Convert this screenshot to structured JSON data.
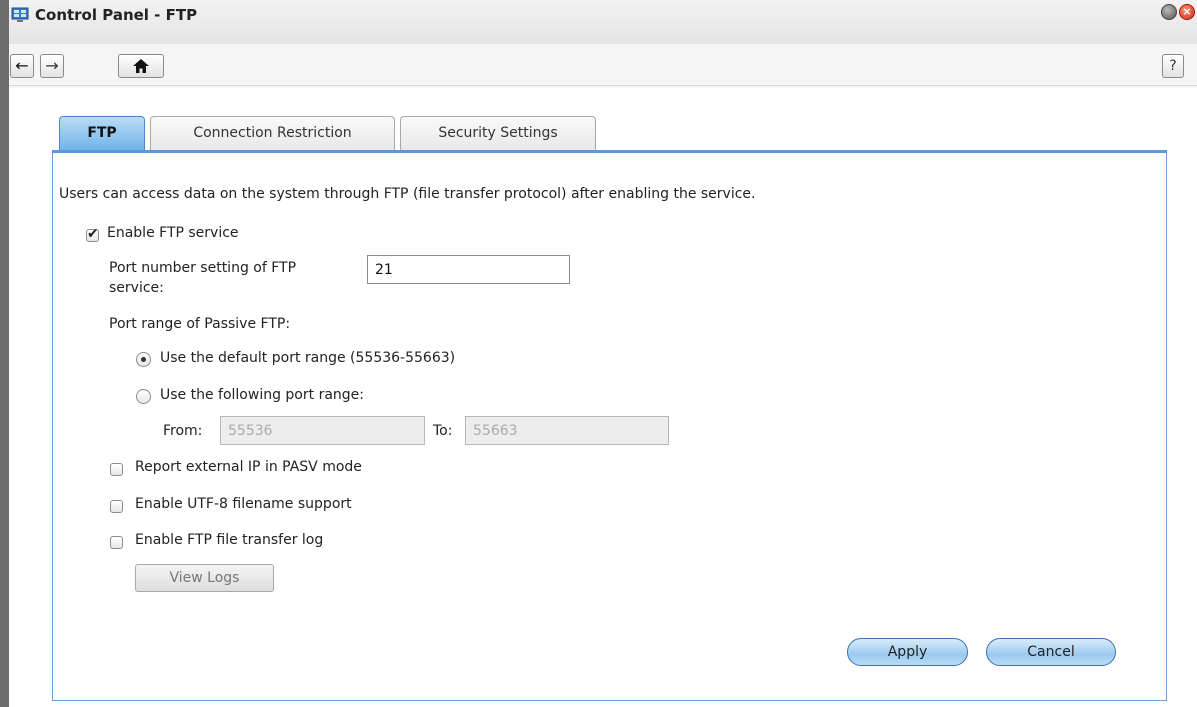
{
  "window": {
    "title": "Control Panel - FTP",
    "app_icon": "control-panel-icon",
    "minimize_icon": "minimize-icon",
    "close_icon": "close-icon"
  },
  "toolbar": {
    "back_icon": "←",
    "forward_icon": "→",
    "home_icon": "⌂",
    "help_label": "?"
  },
  "tabs": [
    {
      "label": "FTP",
      "active": true
    },
    {
      "label": "Connection Restriction",
      "active": false
    },
    {
      "label": "Security Settings",
      "active": false
    }
  ],
  "ftp": {
    "description": "Users can access data on the system through FTP (file transfer protocol) after enabling the service.",
    "enable_ftp": {
      "label": "Enable FTP service",
      "checked": true
    },
    "port_label_line1": "Port number setting of FTP",
    "port_label_line2": "service:",
    "port_value": "21",
    "passive_label": "Port range of Passive FTP:",
    "default_range": {
      "label": "Use the default port range (55536-55663)",
      "selected": true
    },
    "custom_range": {
      "label": "Use the following port range:",
      "selected": false
    },
    "from_label": "From:",
    "from_value": "55536",
    "to_label": "To:",
    "to_value": "55663",
    "report_ip": {
      "label": "Report external IP in PASV mode",
      "checked": false
    },
    "utf8": {
      "label": "Enable UTF-8 filename support",
      "checked": false
    },
    "transfer_log": {
      "label": "Enable FTP file transfer log",
      "checked": false
    },
    "view_logs_label": "View Logs"
  },
  "footer": {
    "apply_label": "Apply",
    "cancel_label": "Cancel"
  },
  "colors": {
    "tab_active": "#6fb2e8",
    "panel_border": "#5b9ad8",
    "close_button": "#d22a10"
  }
}
